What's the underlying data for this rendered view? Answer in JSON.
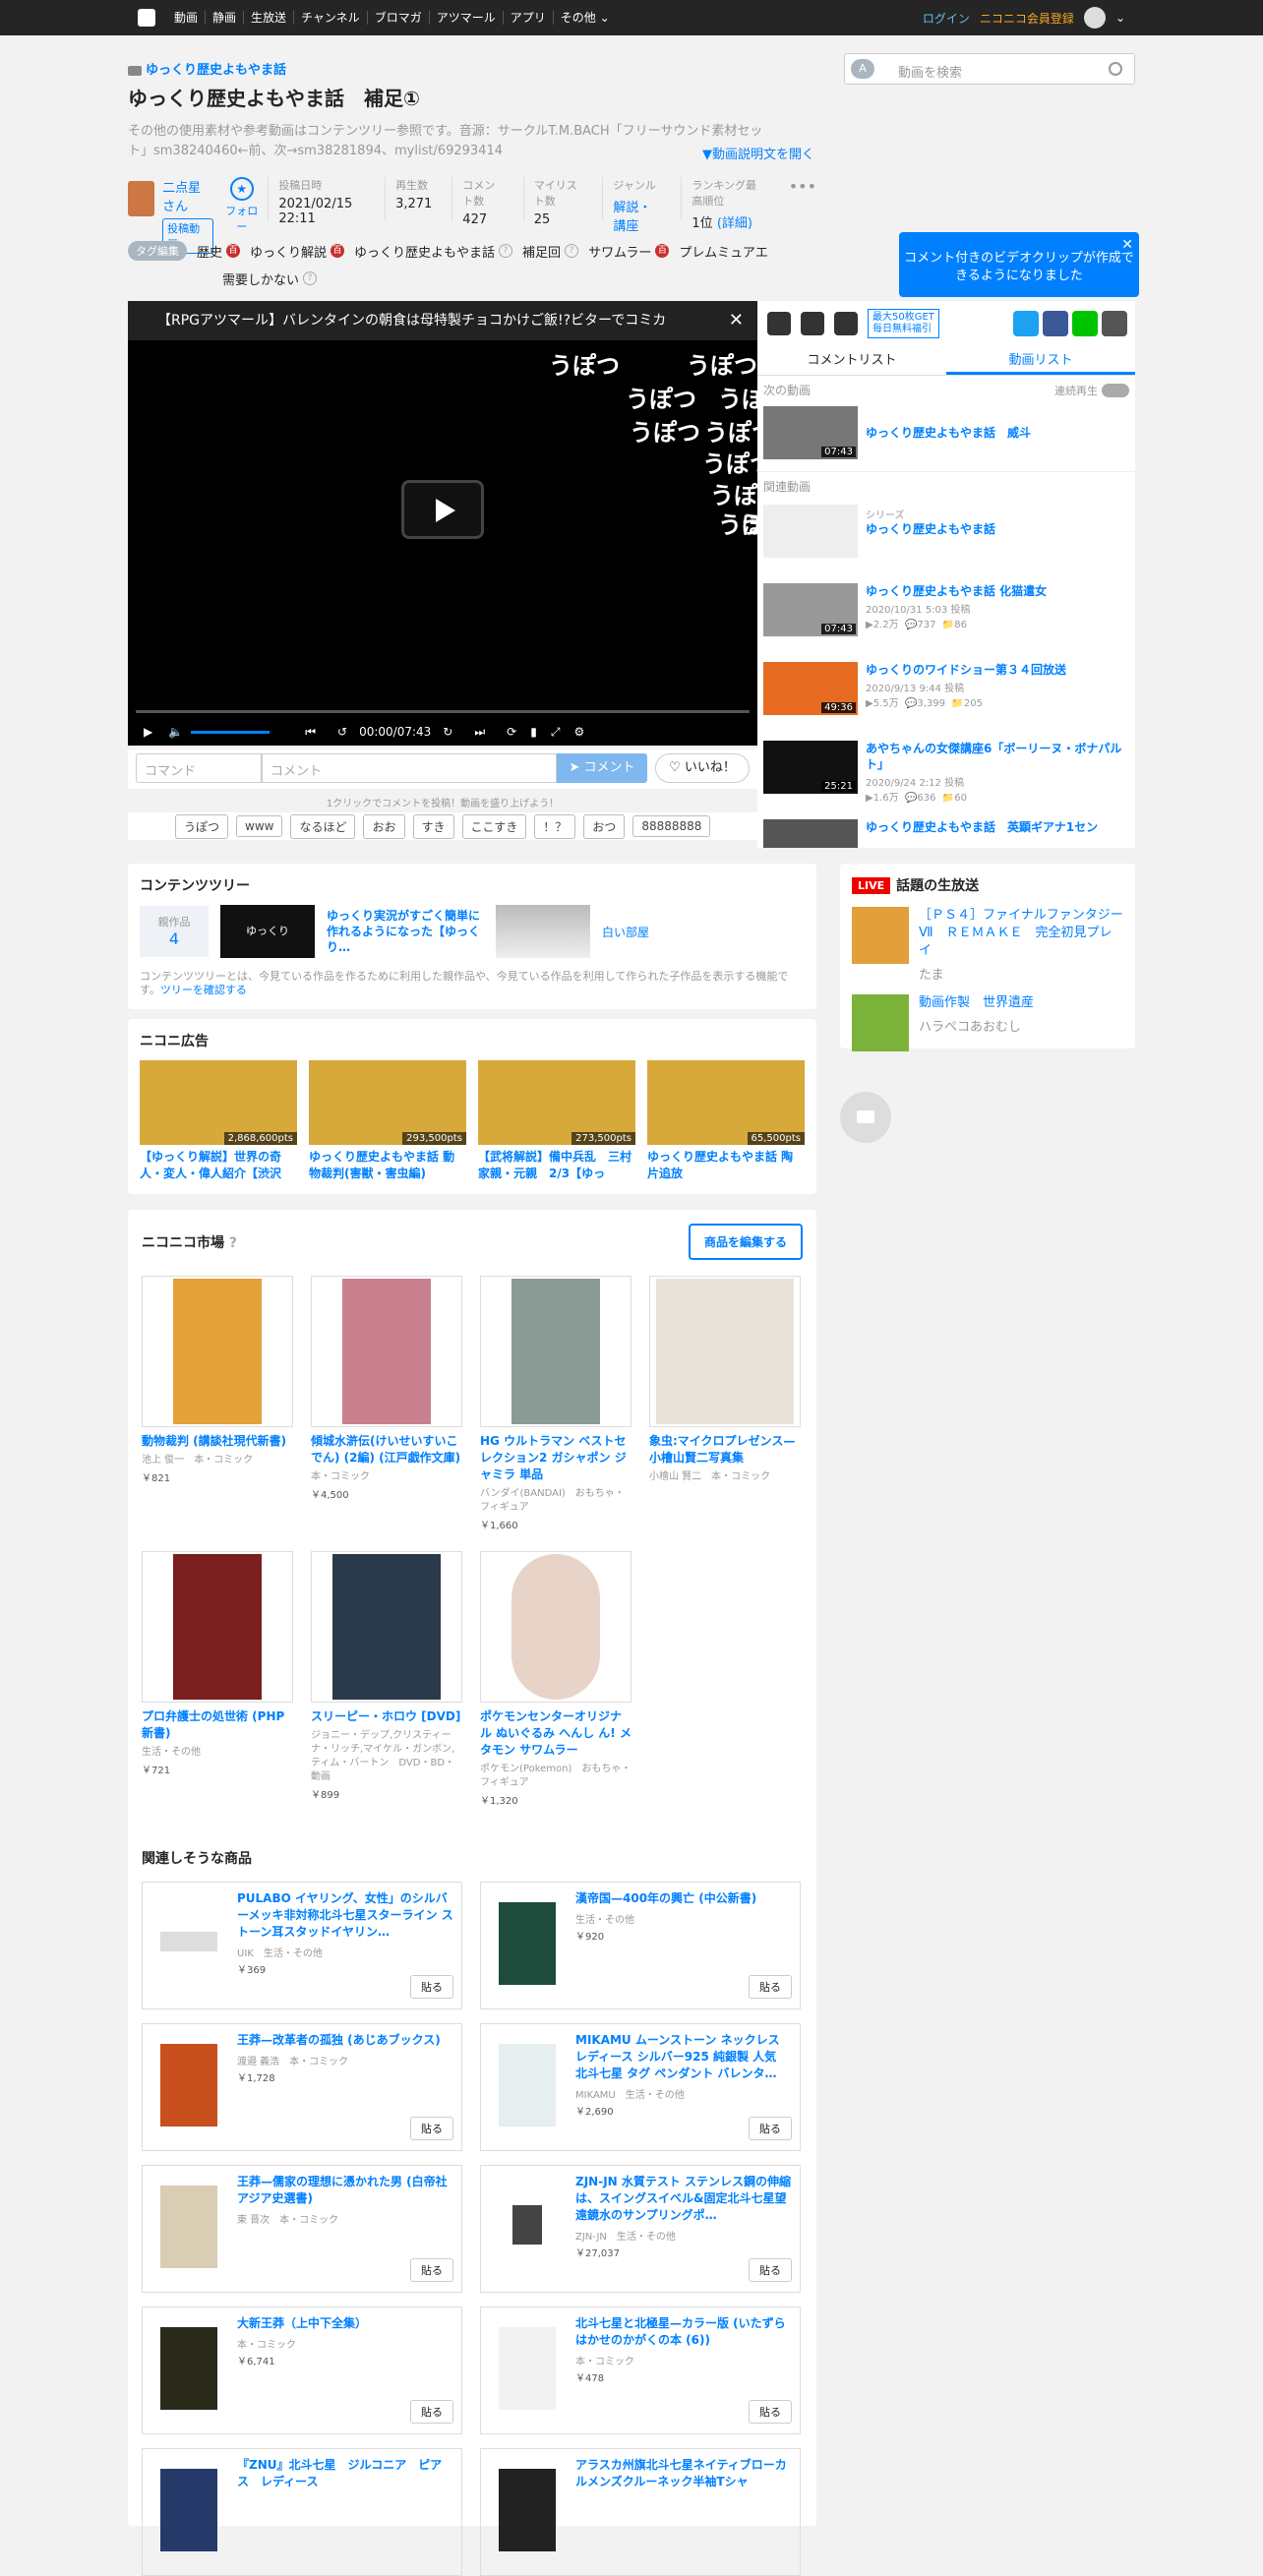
{
  "nav": {
    "items": [
      "動画",
      "静画",
      "生放送",
      "チャンネル",
      "ブロマガ",
      "アツマール",
      "アプリ",
      "その他"
    ],
    "login": "ログイン",
    "register": "ニコニコ会員登録"
  },
  "video": {
    "series": "ゆっくり歴史よもやま話",
    "title": "ゆっくり歴史よもやま話　補足①",
    "description": "その他の使用素材や参考動画はコンテンツリー参照です。音源：サークルT.M.BACH「フリーサウンド素材セット」sm38240460←前、次→sm38281894、mylist/69293414",
    "desc_more": "▼動画説明文を開く",
    "uploader": "二点星 さん",
    "uploader_badge": "投稿動画",
    "follow": "フォロー",
    "stats": [
      {
        "label": "投稿日時",
        "value": "2021/02/15 22:11"
      },
      {
        "label": "再生数",
        "value": "3,271"
      },
      {
        "label": "コメント数",
        "value": "427"
      },
      {
        "label": "マイリスト数",
        "value": "25"
      },
      {
        "label": "ジャンル",
        "value": "解説・講座"
      },
      {
        "label": "ランキング最高順位",
        "value": "1位",
        "extra": "(詳細)"
      }
    ],
    "more": "•••"
  },
  "search": {
    "badge": "A",
    "placeholder": "動画を検索"
  },
  "tags": {
    "edit": "タグ編集",
    "items": [
      "歴史",
      "ゆっくり解説",
      "ゆっくり歴史よもやま話",
      "補足回",
      "サワムラー",
      "プレムミュアエ"
    ],
    "row2": [
      "需要しかない"
    ]
  },
  "tooltip": "コメント付きのビデオクリップが作成できるようになりました",
  "player": {
    "header": "【RPGアツマール】バレンタインの朝食は母特製チョコかけご飯!?ビターでコミカ",
    "overlay": [
      "うぽつ",
      "うぽつ",
      "うぽつ",
      "うぽつ",
      "うぽつ",
      "うぽつ",
      "うぽつ",
      "うぽつ",
      "うぽつ",
      "う"
    ],
    "time": "00:00/07:43"
  },
  "comment": {
    "command_ph": "コマンド",
    "comment_ph": "コメント",
    "send": "コメント",
    "like": "いいね！",
    "hint": "1クリックでコメントを投稿！動画を盛り上げよう！",
    "quick": [
      "うぽつ",
      "www",
      "なるほど",
      "おお",
      "すき",
      "ここすき",
      "！？",
      "おつ",
      "88888888"
    ]
  },
  "sidebar": {
    "gift": "最大50枚GET\n毎日無料福引",
    "tabs": [
      "コメントリスト",
      "動画リスト"
    ],
    "next_label": "次の動画",
    "autoplay": "連続再生",
    "next": {
      "title": "ゆっくり歴史よもやま話　威斗",
      "dur": "07:43"
    },
    "related_label": "関連動画",
    "related": [
      {
        "kind": "シリーズ",
        "title": "ゆっくり歴史よもやま話",
        "meta": ""
      },
      {
        "title": "ゆっくり歴史よもやま話 化猫遣女",
        "meta": "2020/10/31 5:03 投稿\n▶2.2万  💬737  📁86",
        "dur": "07:43"
      },
      {
        "title": "ゆっくりのワイドショー第３４回放送",
        "meta": "2020/9/13 9:44 投稿\n▶5.5万  💬3,399  📁205",
        "dur": "49:36"
      },
      {
        "title": "あやちゃんの女傑講座6「ボーリーヌ・ボナパルト」",
        "meta": "2020/9/24 2:12 投稿\n▶1.6万  💬636  📁60",
        "dur": "25:21"
      },
      {
        "title": "ゆっくり歴史よもやま話　英顕ギアナ1セン",
        "meta": ""
      }
    ]
  },
  "contents_tree": {
    "heading": "コンテンツツリー",
    "parent_label": "親作品",
    "parent_count": "4",
    "items": [
      {
        "title": "ゆっくり実況がすごく簡単に作れるようになった【ゆっくり…",
        "thumb": "ゆっくりMovieMaker 3"
      },
      {
        "title": "白い部屋"
      }
    ],
    "note": "コンテンツツリーとは、今見ている作品を作るために利用した親作品や、今見ている作品を利用して作られた子作品を表示する機能です。",
    "note_link": "ツリーを確認する"
  },
  "ads": {
    "heading": "ニコニ広告",
    "items": [
      {
        "title": "【ゆっくり解説】世界の奇人・変人・偉人紹介【渋沢",
        "pts": "2,868,600pts"
      },
      {
        "title": "ゆっくり歴史よもやま話 動物裁判(害獣・害虫編)",
        "pts": "293,500pts"
      },
      {
        "title": "【武将解説】備中兵乱　三村家親・元親　2/3【ゆっ",
        "pts": "273,500pts"
      },
      {
        "title": "ゆっくり歴史よもやま話 陶片追放",
        "pts": "65,500pts"
      }
    ]
  },
  "market": {
    "heading": "ニコニコ市場",
    "edit": "商品を編集する",
    "items": [
      {
        "title": "動物裁判 (講談社現代新書)",
        "sub": "池上 俊一　本・コミック",
        "price": "￥821"
      },
      {
        "title": "傾城水滸伝(けいせいすいこでん) (2編) (江戸戯作文庫)",
        "sub": "本・コミック",
        "price": "￥4,500"
      },
      {
        "title": "HG ウルトラマン ベストセレクション2 ガシャポン ジャミラ 単品",
        "sub": "バンダイ(BANDAI)　おもちゃ・フィギュア",
        "price": "￥1,660"
      },
      {
        "title": "象虫:マイクロプレゼンス—小檜山賢二写真集",
        "sub": "小檜山 賢二　本・コミック",
        "price": ""
      },
      {
        "title": "プロ弁護士の処世術 (PHP新書)",
        "sub": "生活・その他",
        "price": "￥721"
      },
      {
        "title": "スリーピー・ホロウ [DVD]",
        "sub": "ジョニー・デップ,クリスティーナ・リッチ,マイケル・ガンボン,ティム・バートン　DVD・BD・動画",
        "price": "￥899"
      },
      {
        "title": "ポケモンセンターオリジナル ぬいぐるみ へんし ん! メタモン サワムラー",
        "sub": "ポケモン(Pokemon)　おもちゃ・フィギュア",
        "price": "￥1,320"
      }
    ],
    "related_heading": "関連しそうな商品",
    "related": [
      {
        "title": "PULABO イヤリング、女性」のシルバーメッキ非対称北斗七星スターライン ストーン耳スタッドイヤリン…",
        "sub": "UIK　生活・その他",
        "price": "￥369"
      },
      {
        "title": "漢帝国—400年の興亡 (中公新書)",
        "sub": "生活・その他",
        "price": "￥920"
      },
      {
        "title": "王莽—改革者の孤独 (あじあブックス)",
        "sub": "渡邉 義浩　本・コミック",
        "price": "￥1,728"
      },
      {
        "title": "MIKAMU ムーンストーン ネックレス レディース シルバー925 純銀製 人気 北斗七星 タグ ペンダント バレンタ…",
        "sub": "MIKAMU　生活・その他",
        "price": "￥2,690"
      },
      {
        "title": "王莽—儒家の理想に憑かれた男 (白帝社アジア史選書)",
        "sub": "東 晋次　本・コミック",
        "price": ""
      },
      {
        "title": "ZJN-JN 水質テスト ステンレス鋼の伸縮は、スイングスイベル&固定北斗七星望遠鏡水のサンプリングポ…",
        "sub": "ZJN-JN　生活・その他",
        "price": "￥27,037"
      },
      {
        "title": "大新王莽（上中下全集）",
        "sub": "本・コミック",
        "price": "￥6,741"
      },
      {
        "title": "北斗七星と北極星—カラー版 (いたずらはかせのかがくの本 (6))",
        "sub": "本・コミック",
        "price": "￥478"
      },
      {
        "title": "『ZNU』北斗七星　ジルコニア　ピアス　レディース",
        "sub": "",
        "price": ""
      },
      {
        "title": "アラスカ州旗北斗七星ネイティブローカルメンズクルーネック半袖Tシャ",
        "sub": "",
        "price": ""
      }
    ],
    "paste": "貼る"
  },
  "live": {
    "badge": "LIVE",
    "heading": "話題の生放送",
    "items": [
      {
        "title": "［ＰＳ４］ファイナルファンタジーⅦ　ＲＥＭＡＫＥ　完全初見プレイ",
        "sub": "たま"
      },
      {
        "title": "動画作製　世界遺産",
        "sub": "ハラペコあおむし"
      }
    ]
  }
}
